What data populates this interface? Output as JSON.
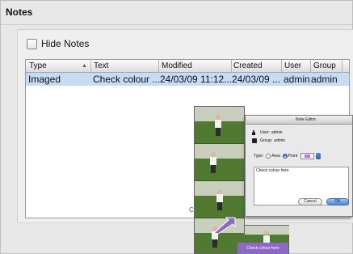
{
  "pane": {
    "title": "Notes",
    "hide_notes_label": "Hide Notes",
    "hide_notes_checked": false
  },
  "table": {
    "columns": [
      "Type",
      "Text",
      "Modified",
      "Created",
      "User",
      "Group"
    ],
    "rows": [
      {
        "type": "Imaged",
        "text": "Check colour ...",
        "modified": "24/03/09 11:12...",
        "created": "24/03/09 ...",
        "user": "admin",
        "group": "admin"
      }
    ],
    "selected_row_color": "#c5dcf5",
    "sorted_column": "Type"
  },
  "bottom_label": "C",
  "note_editor": {
    "title": "Note Editor",
    "user_label": "User:",
    "user_value": "admin",
    "group_label": "Group:",
    "group_value": "admin",
    "type_label": "Type:",
    "type_options": [
      "Area",
      "Point"
    ],
    "type_selected": "Point",
    "note_text": "Check colour here",
    "cancel_label": "Cancel",
    "ok_label": "OK",
    "accent_color": "#2f76d6"
  },
  "callout": {
    "text": "Check colour here",
    "color": "#8f68c7"
  },
  "icons": [
    "person-icon",
    "group-icon",
    "sort-ascending-icon",
    "color-well-icon",
    "stepper-icon",
    "pointer-arrow-icon"
  ]
}
